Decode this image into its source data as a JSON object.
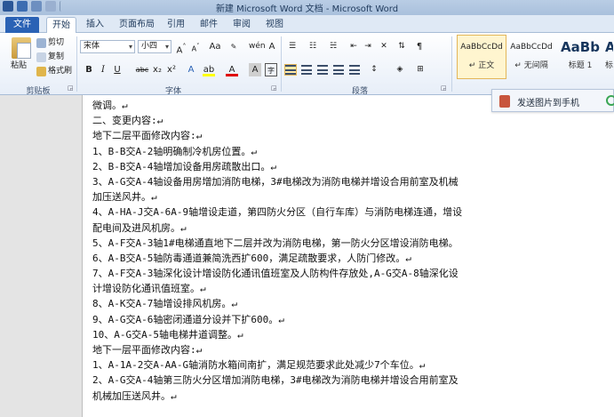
{
  "window": {
    "title": "新建 Microsoft Word 文档 - Microsoft Word"
  },
  "tabs": [
    "文件",
    "开始",
    "插入",
    "页面布局",
    "引用",
    "邮件",
    "审阅",
    "视图"
  ],
  "clipboard": {
    "paste": "粘贴",
    "cut": "剪切",
    "copy": "复制",
    "format_painter": "格式刷",
    "group": "剪贴板"
  },
  "font": {
    "name": "宋体",
    "size": "小四",
    "grow": "A",
    "shrink": "A",
    "aa": "Aa",
    "pinyin": "wén",
    "group": "字体",
    "bold": "B",
    "italic": "I",
    "underline": "U",
    "strike": "abc",
    "sub": "x₂",
    "sup": "x²"
  },
  "paragraph": {
    "group": "段落"
  },
  "styles": {
    "items": [
      {
        "sample": "AaBbCcDd",
        "label": "↵ 正文"
      },
      {
        "sample": "AaBbCcDd",
        "label": "↵ 无间隔"
      },
      {
        "sample": "AaBb",
        "label": "标题 1"
      },
      {
        "sample": "A",
        "label": "标"
      }
    ]
  },
  "popup": {
    "label": "发送图片到手机"
  },
  "document": {
    "lines": [
      "微调。↵",
      "二、变更内容:↵",
      "地下二层平面修改内容:↵",
      "1、B-B交A-2轴明确制冷机房位置。↵",
      "2、B-B交A-4轴增加设备用房疏散出口。↵",
      "3、A-G交A-4轴设备用房增加消防电梯，3#电梯改为消防电梯并增设合用前室及机械",
      "加压送风井。↵",
      "4、A-HA-J交A-6A-9轴增设走道，第四防火分区（自行车库）与消防电梯连通，增设",
      "配电间及进风机房。↵",
      "5、A-F交A-3轴1#电梯通直地下二层并改为消防电梯，第一防火分区增设消防电梯。",
      "6、A-B交A-5轴防毒通道兼简洗西扩600，满足疏散要求，人防门修改。↵",
      "7、A-F交A-3轴深化设计增设防化通讯值班室及人防构件存放处,A-G交A-8轴深化设",
      "计增设防化通讯值班室。↵",
      "8、A-K交A-7轴增设排风机房。↵",
      "9、A-G交A-6轴密闭通道分设并下扩600。↵",
      "10、A-G交A-5轴电梯井道调整。↵",
      "地下一层平面修改内容:↵",
      "1、A-1A-2交A-AA-G轴消防水箱间南扩，满足规范要求此处减少7个车位。↵",
      "2、A-G交A-4轴第三防火分区增加消防电梯，3#电梯改为消防电梯并增设合用前室及",
      "机械加压送风井。↵"
    ]
  },
  "colors": {
    "file_tab": "#2a62b5",
    "ribbon_bg": "#e7eef8",
    "style_selected": "#fff5cf"
  }
}
